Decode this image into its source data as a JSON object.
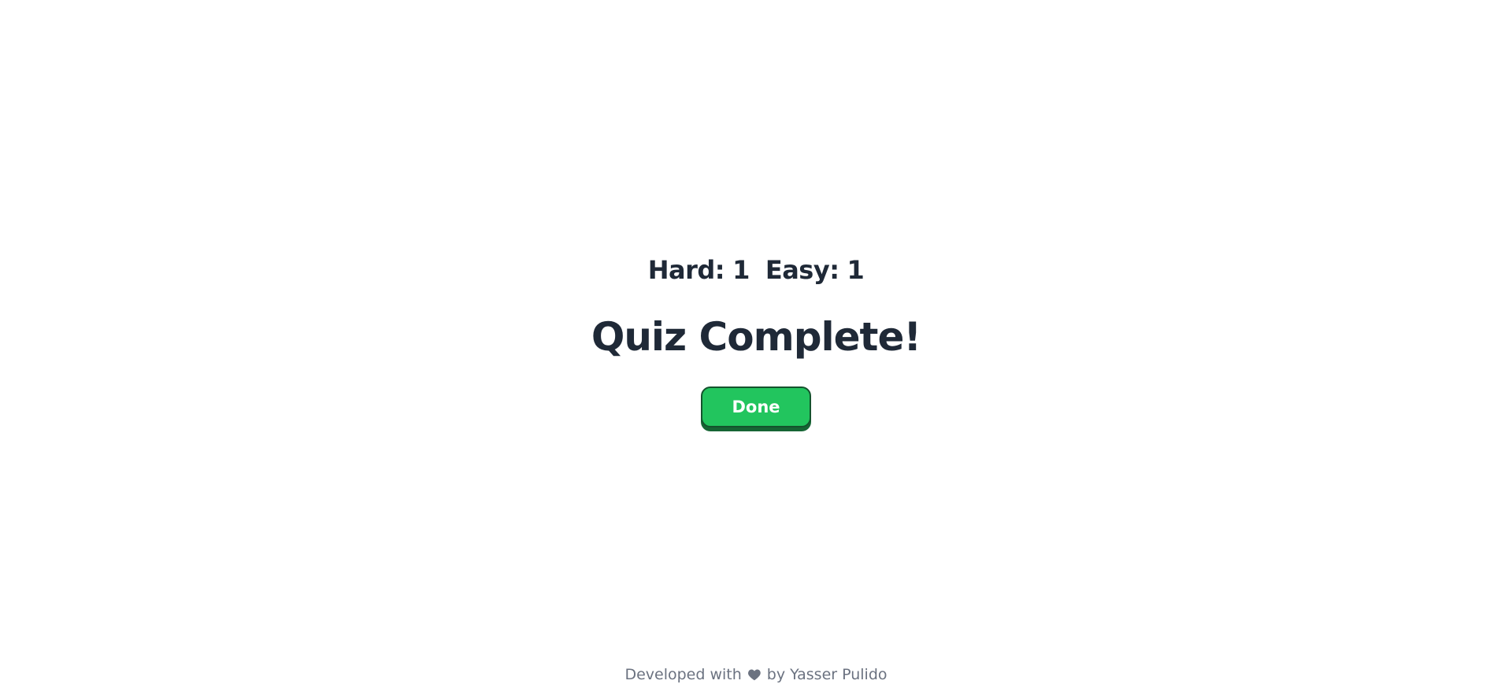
{
  "scores": {
    "hard_label": "Hard:",
    "hard_value": "1",
    "easy_label": "Easy:",
    "easy_value": "1"
  },
  "main": {
    "title": "Quiz Complete!",
    "done_label": "Done"
  },
  "footer": {
    "prefix": "Developed with",
    "icon": "heart-icon",
    "suffix": "by Yasser Pulido"
  },
  "colors": {
    "text": "#1f2937",
    "button": "#22c55e",
    "button_border": "#14532d",
    "footer_text": "#6b7280"
  }
}
